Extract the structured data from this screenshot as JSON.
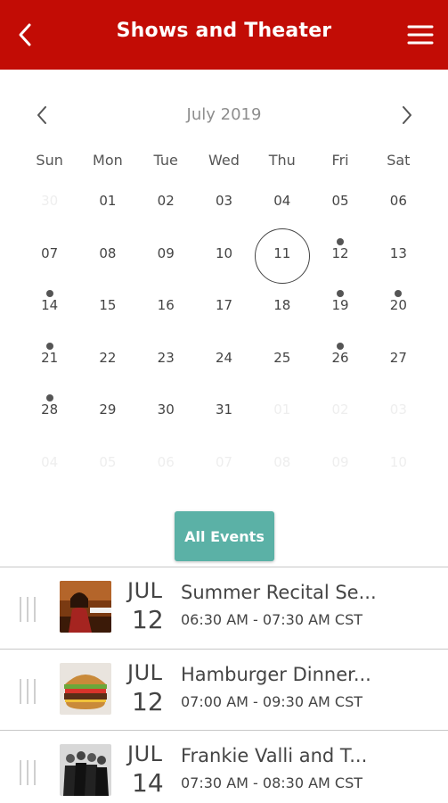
{
  "header": {
    "title": "Shows and Theater",
    "back_icon": "chevron-left-icon",
    "menu_icon": "hamburger-menu-icon",
    "background": "#c20c05"
  },
  "calendar": {
    "month_label": "July 2019",
    "weekdays": [
      "Sun",
      "Mon",
      "Tue",
      "Wed",
      "Thu",
      "Fri",
      "Sat"
    ],
    "selected_day": "11",
    "weeks": [
      [
        "30",
        "01",
        "02",
        "03",
        "04",
        "05",
        "06"
      ],
      [
        "07",
        "08",
        "09",
        "10",
        "11",
        "12",
        "13"
      ],
      [
        "14",
        "15",
        "16",
        "17",
        "18",
        "19",
        "20"
      ],
      [
        "21",
        "22",
        "23",
        "24",
        "25",
        "26",
        "27"
      ],
      [
        "28",
        "29",
        "30",
        "31",
        "01",
        "02",
        "03"
      ],
      [
        "04",
        "05",
        "06",
        "07",
        "08",
        "09",
        "10"
      ]
    ],
    "event_days": [
      "12",
      "14",
      "19",
      "20",
      "21",
      "26",
      "28"
    ]
  },
  "all_events_button": {
    "label": "All Events",
    "color": "#5bb1a6"
  },
  "events": [
    {
      "month": "JUL",
      "day": "12",
      "title": "Summer Recital Se...",
      "time": "06:30 AM - 07:30 AM CST",
      "thumbnail": "recital-pianist-image"
    },
    {
      "month": "JUL",
      "day": "12",
      "title": "Hamburger Dinner...",
      "time": "07:00 AM - 09:30 AM CST",
      "thumbnail": "hamburger-image"
    },
    {
      "month": "JUL",
      "day": "14",
      "title": "Frankie Valli and T...",
      "time": "07:30 AM - 08:30 AM CST",
      "thumbnail": "band-photo-image"
    }
  ]
}
